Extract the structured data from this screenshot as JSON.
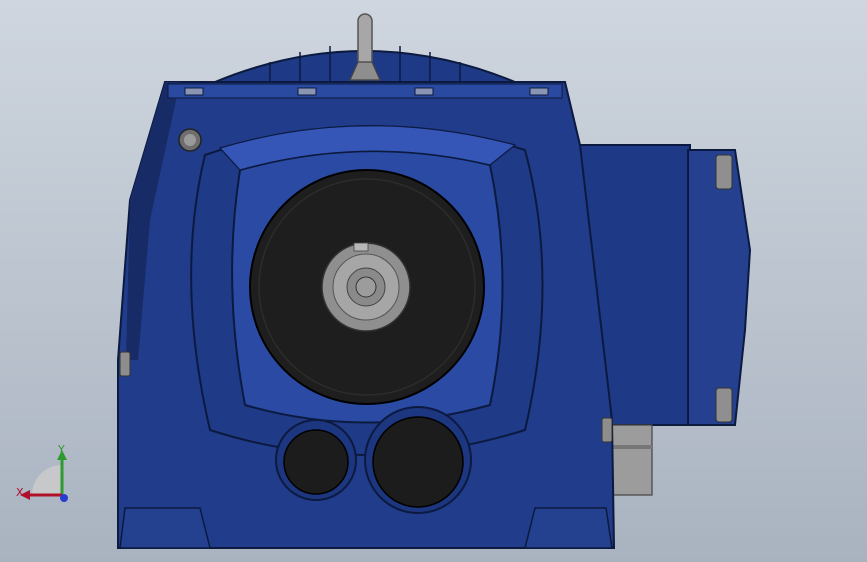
{
  "viewport": {
    "background_top": "#cfd6df",
    "background_bottom": "#a9b3c0"
  },
  "model": {
    "body_color": "#203c8a",
    "body_dark": "#172c66",
    "body_light": "#2f52b0",
    "face_color": "#1f1f1f",
    "shaft_color": "#9a9a9a",
    "metal_color": "#b5b5b5"
  },
  "triad": {
    "x_label": "X",
    "y_label": "Y",
    "x_color": "#b0102a",
    "y_color": "#2f9a2f",
    "z_color": "#2a3cd0"
  }
}
